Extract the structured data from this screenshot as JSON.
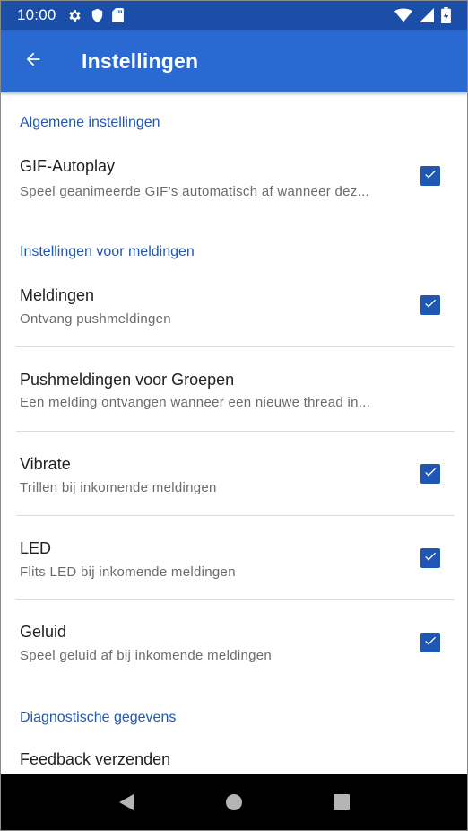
{
  "status_bar": {
    "time": "10:00",
    "icons_left": [
      "gear-icon",
      "shield-icon",
      "sd-card-icon"
    ],
    "icons_right": [
      "wifi-icon",
      "cell-signal-icon",
      "battery-charging-icon"
    ]
  },
  "app_bar": {
    "title": "Instellingen",
    "back_icon": "arrow-left-icon"
  },
  "sections": [
    {
      "header": "Algemene instellingen",
      "items": [
        {
          "title": "GIF-Autoplay",
          "summary": "Speel geanimeerde GIF’s automatisch af wanneer dez...",
          "checked": true
        }
      ]
    },
    {
      "header": "Instellingen voor meldingen",
      "items": [
        {
          "title": "Meldingen",
          "summary": "Ontvang pushmeldingen",
          "checked": true
        },
        {
          "title": "Pushmeldingen voor Groepen",
          "summary": "Een melding ontvangen wanneer een nieuwe thread in...",
          "checked": null
        },
        {
          "title": "Vibrate",
          "summary": "Trillen bij inkomende meldingen",
          "checked": true
        },
        {
          "title": "LED",
          "summary": "Flits LED bij inkomende meldingen",
          "checked": true
        },
        {
          "title": "Geluid",
          "summary": "Speel geluid af bij inkomende meldingen",
          "checked": true
        }
      ]
    },
    {
      "header": "Diagnostische gegevens",
      "items": [
        {
          "title": "Feedback verzenden",
          "summary": "",
          "checked": null
        }
      ]
    }
  ],
  "nav_bar": {
    "buttons": [
      "back-triangle-icon",
      "home-circle-icon",
      "recents-square-icon"
    ]
  },
  "colors": {
    "status_bar": "#1a4ea8",
    "app_bar": "#2969d1",
    "accent": "#1f57b3",
    "nav_bar": "#000000"
  }
}
